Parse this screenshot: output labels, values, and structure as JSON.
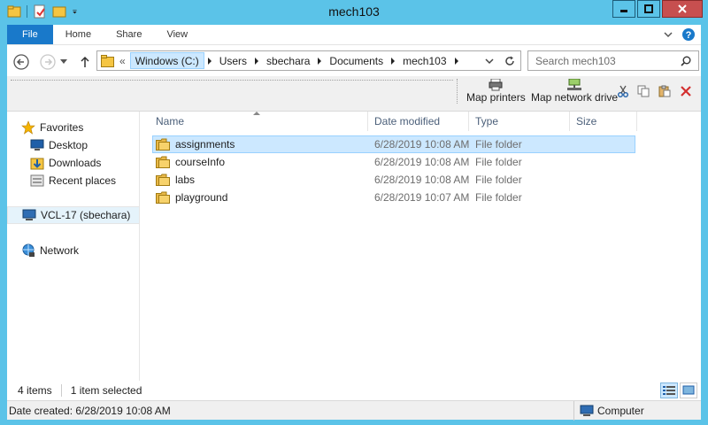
{
  "window": {
    "title": "mech103"
  },
  "ribbon": {
    "tabs": [
      {
        "label": "File"
      },
      {
        "label": "Home"
      },
      {
        "label": "Share"
      },
      {
        "label": "View"
      }
    ]
  },
  "address": {
    "overflow": "«",
    "crumbs": [
      "Windows (C:)",
      "Users",
      "sbechara",
      "Documents",
      "mech103"
    ]
  },
  "search": {
    "placeholder": "Search mech103"
  },
  "toolbar": {
    "map_printers": "Map printers",
    "map_network_drive": "Map network drive"
  },
  "nav": {
    "favorites": "Favorites",
    "desktop": "Desktop",
    "downloads": "Downloads",
    "recent": "Recent places",
    "computer": "VCL-17 (sbechara)",
    "network": "Network"
  },
  "columns": {
    "name": "Name",
    "date": "Date modified",
    "type": "Type",
    "size": "Size"
  },
  "files": [
    {
      "name": "assignments",
      "date": "6/28/2019 10:08 AM",
      "type": "File folder"
    },
    {
      "name": "courseInfo",
      "date": "6/28/2019 10:08 AM",
      "type": "File folder"
    },
    {
      "name": "labs",
      "date": "6/28/2019 10:08 AM",
      "type": "File folder"
    },
    {
      "name": "playground",
      "date": "6/28/2019 10:07 AM",
      "type": "File folder"
    }
  ],
  "status": {
    "count": "4 items",
    "selected": "1 item selected"
  },
  "details": {
    "date_created": "Date created: 6/28/2019 10:08 AM",
    "location": "Computer"
  },
  "colors": {
    "title_bar": "#5bc3e8",
    "file_tab": "#1979ca",
    "selection": "#cce8ff",
    "close": "#c74f4f"
  }
}
